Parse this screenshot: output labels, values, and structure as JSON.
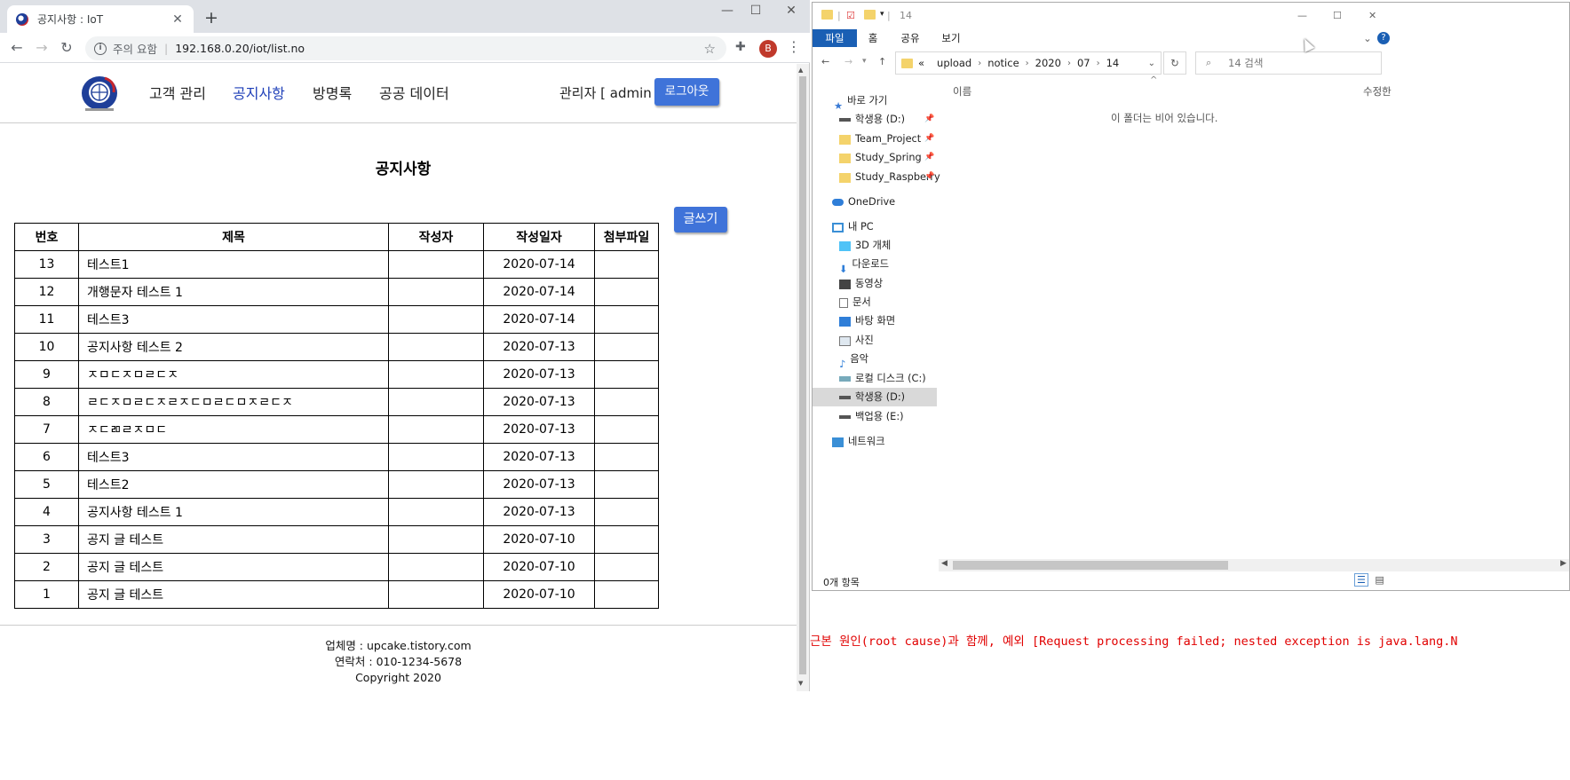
{
  "browser": {
    "tab_title": "공지사항 : IoT",
    "tab_close": "✕",
    "new_tab": "+",
    "security_label": "주의 요함",
    "url": "192.168.0.20/iot/list.no",
    "avatar_letter": "B",
    "minimize": "—",
    "maximize": "☐",
    "close": "✕"
  },
  "site": {
    "nav": [
      "고객 관리",
      "공지사항",
      "방명록",
      "공공 데이터"
    ],
    "active_nav": "공지사항",
    "admin_text": "관리자 [ admin ]",
    "logout_label": "로그아웃",
    "page_title": "공지사항",
    "write_label": "글쓰기",
    "accent_color": "#3f73d9",
    "active_nav_color": "#1e3fb8"
  },
  "table": {
    "headers": [
      "번호",
      "제목",
      "작성자",
      "작성일자",
      "첨부파일"
    ],
    "rows": [
      {
        "no": "13",
        "title": "테스트1",
        "writer": "",
        "date": "2020-07-14",
        "file": ""
      },
      {
        "no": "12",
        "title": "개행문자 테스트 1",
        "writer": "",
        "date": "2020-07-14",
        "file": ""
      },
      {
        "no": "11",
        "title": "테스트3",
        "writer": "",
        "date": "2020-07-14",
        "file": ""
      },
      {
        "no": "10",
        "title": "공지사항 테스트 2",
        "writer": "",
        "date": "2020-07-13",
        "file": ""
      },
      {
        "no": "9",
        "title": "ㅈㅁㄷㅈㅁㄹㄷㅈ",
        "writer": "",
        "date": "2020-07-13",
        "file": ""
      },
      {
        "no": "8",
        "title": "ㄹㄷㅈㅁㄹㄷㅈㄹㅈㄷㅁㄹㄷㅁㅈㄹㄷㅈ",
        "writer": "",
        "date": "2020-07-13",
        "file": ""
      },
      {
        "no": "7",
        "title": "ㅈㄷㄻㄹㅈㅁㄷ",
        "writer": "",
        "date": "2020-07-13",
        "file": ""
      },
      {
        "no": "6",
        "title": "테스트3",
        "writer": "",
        "date": "2020-07-13",
        "file": ""
      },
      {
        "no": "5",
        "title": "테스트2",
        "writer": "",
        "date": "2020-07-13",
        "file": ""
      },
      {
        "no": "4",
        "title": "공지사항 테스트 1",
        "writer": "",
        "date": "2020-07-13",
        "file": ""
      },
      {
        "no": "3",
        "title": "공지 글 테스트",
        "writer": "",
        "date": "2020-07-10",
        "file": ""
      },
      {
        "no": "2",
        "title": "공지 글 테스트",
        "writer": "",
        "date": "2020-07-10",
        "file": ""
      },
      {
        "no": "1",
        "title": "공지 글 테스트",
        "writer": "",
        "date": "2020-07-10",
        "file": ""
      }
    ]
  },
  "footer": {
    "company": "업체명 : upcake.tistory.com",
    "contact": "연락처 : 010-1234-5678",
    "copyright": "Copyright 2020"
  },
  "explorer": {
    "title": "14",
    "ribbon": [
      "파일",
      "홈",
      "공유",
      "보기"
    ],
    "breadcrumb_prefix": "«",
    "breadcrumb": [
      "upload",
      "notice",
      "2020",
      "07",
      "14"
    ],
    "search_placeholder": "14 검색",
    "column_name": "이름",
    "column_modified": "수정한",
    "empty_message": "이 폴더는 비어 있습니다.",
    "status": "0개 항목",
    "nav_items": [
      {
        "label": "바로 가기",
        "icon": "star-icon"
      },
      {
        "label": "학생용 (D:)",
        "icon": "drive-icon",
        "pinned": true
      },
      {
        "label": "Team_Project",
        "icon": "folder-icon",
        "pinned": true
      },
      {
        "label": "Study_Spring",
        "icon": "folder-icon",
        "pinned": true
      },
      {
        "label": "Study_Raspberry",
        "icon": "folder-icon",
        "pinned": true
      },
      {
        "label": "OneDrive",
        "icon": "cloud-icon"
      },
      {
        "label": "내 PC",
        "icon": "pc-icon"
      },
      {
        "label": "3D 개체",
        "icon": "cube-icon"
      },
      {
        "label": "다운로드",
        "icon": "download-icon"
      },
      {
        "label": "동영상",
        "icon": "video-icon"
      },
      {
        "label": "문서",
        "icon": "document-icon"
      },
      {
        "label": "바탕 화면",
        "icon": "desktop-icon"
      },
      {
        "label": "사진",
        "icon": "picture-icon"
      },
      {
        "label": "음악",
        "icon": "music-icon"
      },
      {
        "label": "로컬 디스크 (C:)",
        "icon": "disk-icon"
      },
      {
        "label": "학생용 (D:)",
        "icon": "drive-icon",
        "selected": true
      },
      {
        "label": "백업용 (E:)",
        "icon": "drive-icon"
      },
      {
        "label": "네트워크",
        "icon": "network-icon"
      }
    ]
  },
  "console": {
    "error_text": "근본 원인(root cause)과 함께, 예외 [Request processing failed; nested exception is java.lang.N"
  }
}
